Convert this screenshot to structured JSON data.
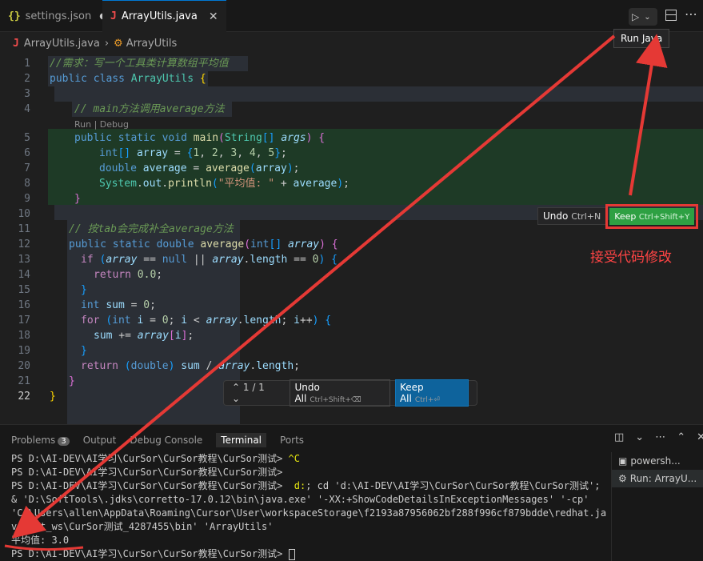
{
  "tabs": [
    {
      "icon": "{}",
      "label": "settings.json",
      "modified_marker": "●"
    },
    {
      "icon": "J",
      "label": "ArrayUtils.java",
      "close": "✕"
    }
  ],
  "toolbar": {
    "run_icon": "▷",
    "dropdown": "⌄",
    "more": "⋯",
    "tooltip": "Run Java"
  },
  "breadcrumb": {
    "file_icon": "J",
    "file": "ArrayUtils.java",
    "sep": "›",
    "symbol_icon": "⚙",
    "symbol": "ArrayUtils"
  },
  "editor": {
    "line_numbers": [
      "1",
      "2",
      "3",
      "4",
      "5",
      "6",
      "7",
      "8",
      "9",
      "10",
      "11",
      "12",
      "13",
      "14",
      "15",
      "16",
      "17",
      "18",
      "19",
      "20",
      "21",
      "22"
    ],
    "codelens": "Run | Debug",
    "l1": "//需求：写一个工具类计算数组平均值",
    "l4": "// main方法调用average方法",
    "l11": "// 按tab会完成补全average方法",
    "strlit": "\"平均值: \""
  },
  "inline_actions": {
    "undo": "Undo",
    "undo_key": "Ctrl+N",
    "keep": "Keep",
    "keep_key": "Ctrl+Shift+Y"
  },
  "annotation": "接受代码修改",
  "floatbar": {
    "nav": "⌃ 1 / 1 ⌄",
    "undo_all": "Undo All",
    "undo_all_key": "Ctrl+Shift+⌫",
    "keep_all": "Keep All",
    "keep_all_key": "Ctrl+⏎"
  },
  "panel": {
    "tabs": {
      "problems": "Problems",
      "problems_count": "3",
      "output": "Output",
      "debug": "Debug Console",
      "terminal": "Terminal",
      "ports": "Ports"
    },
    "tools": {
      "split": "◫",
      "chev": "⌄",
      "more": "⋯",
      "max": "⌃",
      "close": "✕"
    },
    "terminal_lines": {
      "p1": "PS D:\\AI-DEV\\AI学习\\CurSor\\CurSor教程\\CurSor测试> ",
      "c1": "^C",
      "p2": "PS D:\\AI-DEV\\AI学习\\CurSor\\CurSor教程\\CurSor测试>",
      "p3": "PS D:\\AI-DEV\\AI学习\\CurSor\\CurSor教程\\CurSor测试> ",
      "c3a": " d:",
      "c3b": "; cd 'd:\\AI-DEV\\AI学习\\CurSor\\CurSor教程\\CurSor测试'; & 'D:\\SoftTools\\.jdks\\corretto-17.0.12\\bin\\java.exe' '-XX:+ShowCodeDetailsInExceptionMessages' '-cp' 'C:\\Users\\allen\\AppData\\Roaming\\Cursor\\User\\workspaceStorage\\f2193a87956062bf288f996cf879bdde\\redhat.java\\jdt_ws\\CurSor测试_4287455\\bin' 'ArrayUtils'",
      "out": "平均值: 3.0",
      "p4": "PS D:\\AI-DEV\\AI学习\\CurSor\\CurSor教程\\CurSor测试> "
    },
    "term_list": [
      {
        "icon": "▣",
        "label": "powersh..."
      },
      {
        "icon": "⚙",
        "label": "Run: ArrayU..."
      }
    ]
  },
  "colors": {
    "accent": "#0078d4",
    "keep_green": "#2ea043",
    "annotation_red": "#e53935"
  }
}
